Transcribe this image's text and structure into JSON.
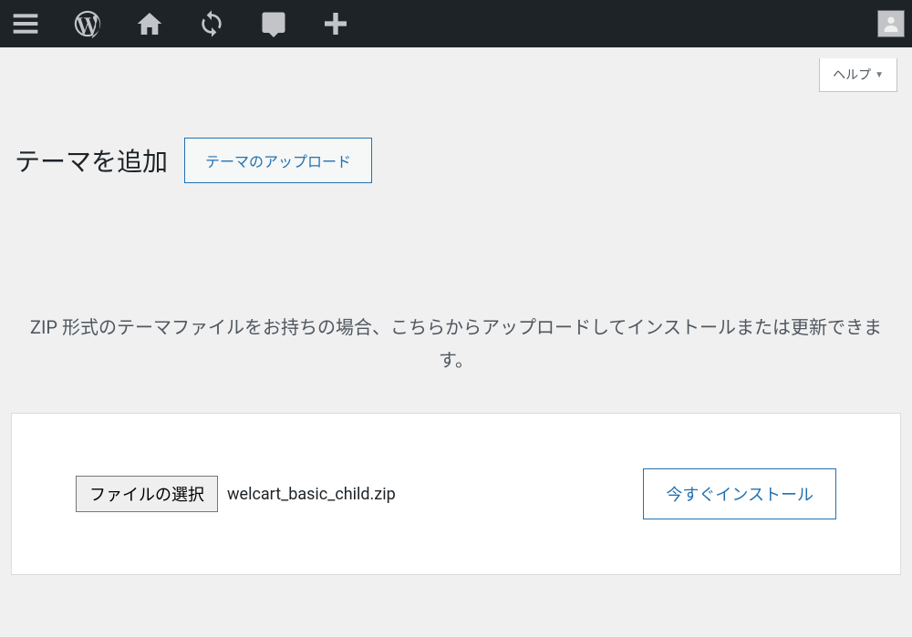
{
  "help_tab": {
    "label": "ヘルプ"
  },
  "page": {
    "title": "テーマを追加",
    "upload_button": "テーマのアップロード",
    "instruction": "ZIP 形式のテーマファイルをお持ちの場合、こちらからアップロードしてインストールまたは更新できます。"
  },
  "upload_form": {
    "file_select_label": "ファイルの選択",
    "selected_file": "welcart_basic_child.zip",
    "install_label": "今すぐインストール"
  }
}
